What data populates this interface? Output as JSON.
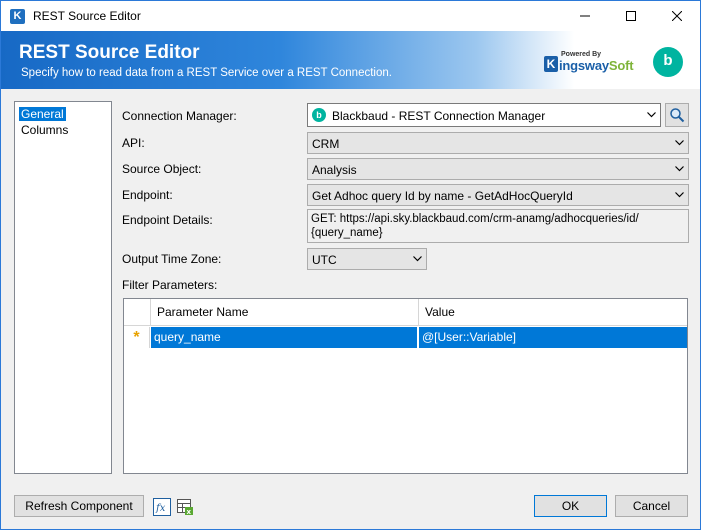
{
  "window": {
    "title": "REST Source Editor",
    "app_icon_letter": "K"
  },
  "banner": {
    "title": "REST Source Editor",
    "subtitle": "Specify how to read data from a REST Service over a REST Connection.",
    "brand_powered_by": "Powered By",
    "brand_k": "K",
    "brand_name_a": "ingsway",
    "brand_name_b": "Soft",
    "partner_logo_letter": "b"
  },
  "nav": {
    "items": [
      {
        "label": "General",
        "selected": true
      },
      {
        "label": "Columns",
        "selected": false
      }
    ]
  },
  "form": {
    "connection_manager_label": "Connection Manager:",
    "connection_manager_value": "Blackbaud - REST Connection Manager",
    "api_label": "API:",
    "api_value": "CRM",
    "source_object_label": "Source Object:",
    "source_object_value": "Analysis",
    "endpoint_label": "Endpoint:",
    "endpoint_value": "Get Adhoc query Id by name - GetAdHocQueryId",
    "endpoint_details_label": "Endpoint Details:",
    "endpoint_details_line1": "GET: https://api.sky.blackbaud.com/crm-anamg/adhocqueries/id/",
    "endpoint_details_line2": "{query_name}",
    "output_time_zone_label": "Output Time Zone:",
    "output_time_zone_value": "UTC",
    "filter_parameters_label": "Filter Parameters:"
  },
  "grid": {
    "columns": [
      "Parameter Name",
      "Value"
    ],
    "rows": [
      {
        "indicator": "*",
        "name": "query_name",
        "value": "@[User::Variable]"
      }
    ]
  },
  "footer": {
    "refresh_label": "Refresh Component",
    "ok_label": "OK",
    "cancel_label": "Cancel"
  },
  "colors": {
    "selection": "#0078d7",
    "banner_blue": "#1769c5",
    "blackbaud_teal": "#00b4a0"
  }
}
